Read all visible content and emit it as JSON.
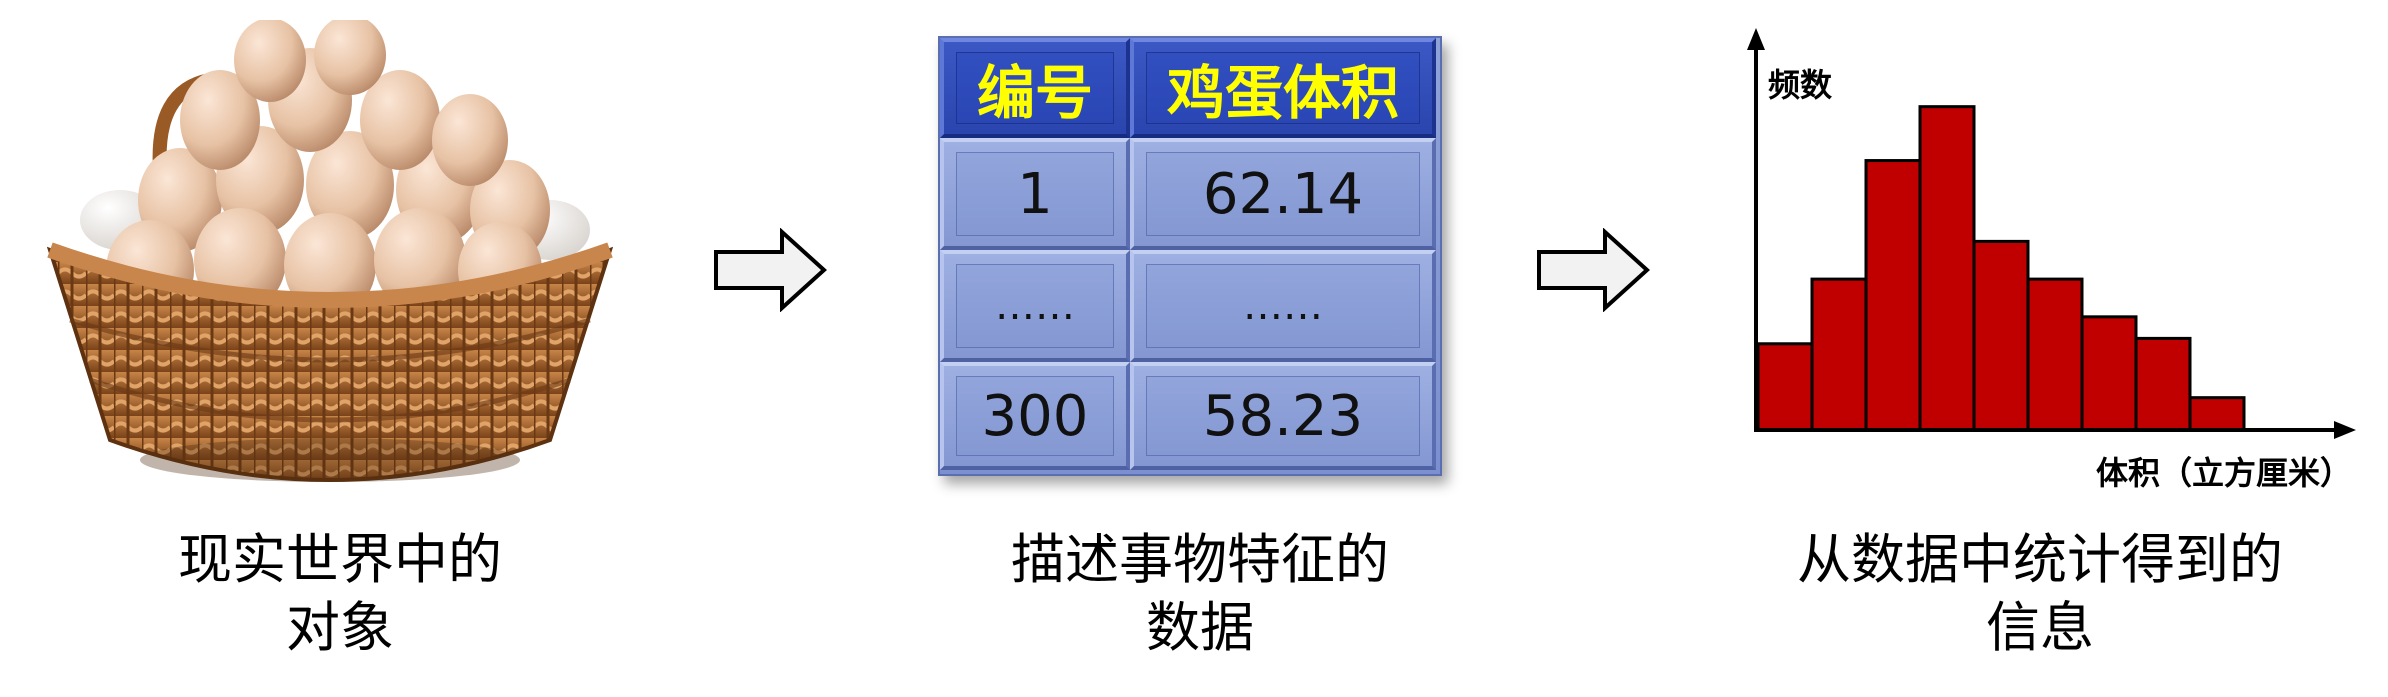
{
  "captions": {
    "object": {
      "line1": "现实世界中的",
      "line2": "对象"
    },
    "data": {
      "line1": "描述事物特征的",
      "line2": "数据"
    },
    "info": {
      "line1": "从数据中统计得到的",
      "line2": "信息"
    }
  },
  "table": {
    "headers": [
      "编号",
      "鸡蛋体积"
    ],
    "rows": [
      [
        "1",
        "62.14"
      ],
      [
        "……",
        "……"
      ],
      [
        "300",
        "58.23"
      ]
    ]
  },
  "chart_data": {
    "type": "bar",
    "title": "",
    "xlabel": "体积（立方厘米）",
    "ylabel": "频数",
    "values": [
      1.6,
      2.8,
      5.0,
      6.0,
      3.5,
      2.8,
      2.1,
      1.7,
      0.6
    ],
    "ylim": [
      0,
      7.2
    ],
    "bar_color": "#c00000",
    "grid": false
  },
  "colors": {
    "table_header_bg": "#2f4dba",
    "table_header_text": "#ffff00",
    "table_cell_bg": "#8fa2d8",
    "bar_fill": "#c00000",
    "basket": "#a0622d",
    "egg": "#e7c2a4"
  }
}
